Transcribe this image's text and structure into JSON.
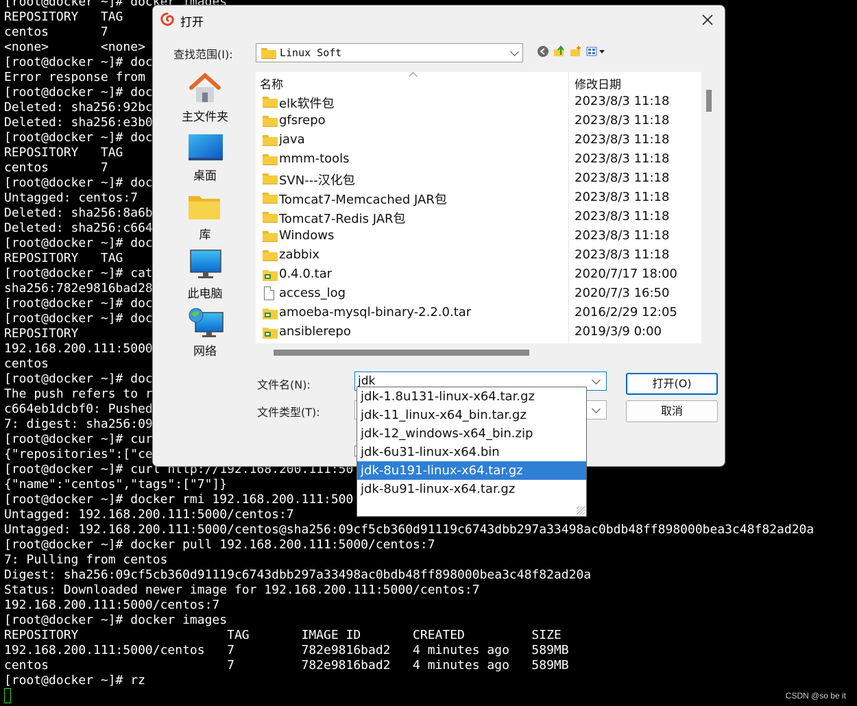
{
  "terminal": {
    "lines": [
      "[root@docker ~]# docker images",
      "REPOSITORY   TAG",
      "centos       7",
      "<none>       <none>",
      "[root@docker ~]# doc",
      "Error response from",
      "[root@docker ~]# doc",
      "Deleted: sha256:92bc",
      "Deleted: sha256:e3b0",
      "[root@docker ~]# doc",
      "REPOSITORY   TAG",
      "centos       7",
      "[root@docker ~]# doc",
      "Untagged: centos:7",
      "Deleted: sha256:8a6b",
      "Deleted: sha256:c664",
      "[root@docker ~]# doc",
      "REPOSITORY   TAG",
      "[root@docker ~]# cat",
      "sha256:782e9816bad28",
      "[root@docker ~]# doc",
      "[root@docker ~]# doc",
      "REPOSITORY",
      "192.168.200.111:5000",
      "centos",
      "[root@docker ~]# doc",
      "The push refers to r",
      "c664eb1dcbf0: Pushed",
      "7: digest: sha256:09",
      "[root@docker ~]# cur",
      "{\"repositories\":[\"ce",
      "[root@docker ~]# curl http://192.168.200.111:50",
      "{\"name\":\"centos\",\"tags\":[\"7\"]}",
      "[root@docker ~]# docker rmi 192.168.200.111:500",
      "Untagged: 192.168.200.111:5000/centos:7",
      "Untagged: 192.168.200.111:5000/centos@sha256:09cf5cb360d91119c6743dbb297a33498ac0bdb48ff898000bea3c48f82ad20a",
      "[root@docker ~]# docker pull 192.168.200.111:5000/centos:7",
      "7: Pulling from centos",
      "Digest: sha256:09cf5cb360d91119c6743dbb297a33498ac0bdb48ff898000bea3c48f82ad20a",
      "Status: Downloaded newer image for 192.168.200.111:5000/centos:7",
      "192.168.200.111:5000/centos:7",
      "[root@docker ~]# docker images",
      "REPOSITORY                    TAG       IMAGE ID       CREATED         SIZE",
      "192.168.200.111:5000/centos   7         782e9816bad2   4 minutes ago   589MB",
      "centos                        7         782e9816bad2   4 minutes ago   589MB",
      "[root@docker ~]# rz"
    ]
  },
  "watermark": "CSDN @so be it",
  "dialog": {
    "title": "打开",
    "look_in_label": "查找范围(I):",
    "look_in_value": "Linux Soft",
    "places": [
      "主文件夹",
      "桌面",
      "库",
      "此电脑",
      "网络"
    ],
    "columns": {
      "name": "名称",
      "date": "修改日期"
    },
    "files": [
      {
        "name": "elk软件包",
        "date": "2023/8/3 11:18",
        "icon": "folder-icon"
      },
      {
        "name": "gfsrepo",
        "date": "2023/8/3 11:18",
        "icon": "folder-icon"
      },
      {
        "name": "java",
        "date": "2023/8/3 11:18",
        "icon": "folder-icon"
      },
      {
        "name": "mmm-tools",
        "date": "2023/8/3 11:18",
        "icon": "folder-icon"
      },
      {
        "name": "SVN---汉化包",
        "date": "2023/8/3 11:18",
        "icon": "folder-icon"
      },
      {
        "name": "Tomcat7-Memcached JAR包",
        "date": "2023/8/3 11:18",
        "icon": "folder-icon"
      },
      {
        "name": "Tomcat7-Redis JAR包",
        "date": "2023/8/3 11:18",
        "icon": "folder-icon"
      },
      {
        "name": "Windows",
        "date": "2023/8/3 11:18",
        "icon": "folder-icon"
      },
      {
        "name": "zabbix",
        "date": "2023/8/3 11:18",
        "icon": "folder-icon"
      },
      {
        "name": "0.4.0.tar",
        "date": "2020/7/17 18:00",
        "icon": "archive-icon"
      },
      {
        "name": "access_log",
        "date": "2020/7/3 16:50",
        "icon": "file-icon"
      },
      {
        "name": "amoeba-mysql-binary-2.2.0.tar",
        "date": "2016/2/29 12:05",
        "icon": "archive-icon"
      },
      {
        "name": "ansiblerepo",
        "date": "2019/3/9 0:00",
        "icon": "archive-icon"
      }
    ],
    "filename_label": "文件名(N):",
    "filename_value": "jdk",
    "filetype_label": "文件类型(T):",
    "open_label": "打开(O)",
    "cancel_label": "取消",
    "autocomplete": [
      "jdk-1.8u131-linux-x64.tar.gz",
      "jdk-11_linux-x64_bin.tar.gz",
      "jdk-12_windows-x64_bin.zip",
      "jdk-6u31-linux-x64.bin",
      "jdk-8u191-linux-x64.tar.gz",
      "jdk-8u91-linux-x64.tar.gz"
    ],
    "autocomplete_selected": 4
  },
  "colors": {
    "selection": "#2f7fd5",
    "accent": "#0067c0",
    "cursor": "#22e022"
  }
}
